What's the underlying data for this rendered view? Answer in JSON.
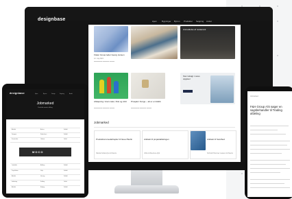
{
  "monitor": {
    "logo": "designbase",
    "nav": [
      "Hjem",
      "Bygninger",
      "Byrum",
      "Produkter",
      "Søgning",
      "Andet"
    ],
    "cards": [
      {
        "title": "Fisker Group leder Georg Jensen",
        "date": "12. maj 2024"
      },
      {
        "title": "Anmeldelse af restaurant",
        "date": ""
      },
      {
        "title": "Afslapning: Grøn natur, frisk og vildt",
        "date": ""
      },
      {
        "title": "Prosjekt i Norge – alt er en fabrik",
        "date": ""
      },
      {
        "title": "Stor indsigt i vores opgaver",
        "date": ""
      }
    ],
    "jobs_heading": "Jobmarked",
    "job_cards": [
      {
        "title": "Produktionsmedarbejder til Neuer Berlin",
        "company": "Nikolai Kotlarczyk Architects"
      },
      {
        "title": "Arkitekt til projektafdelingen",
        "company": "Ulrik Architecture ApS"
      },
      {
        "title": "Arkitekt til Sundhed",
        "company": "Schmidt Hammer Lassen Architects"
      }
    ]
  },
  "tablet": {
    "logo": "designbase",
    "nav": [
      "Hjem",
      "Byrum",
      "Design",
      "Søgning",
      "Andet"
    ],
    "title": "Jobmarked",
    "subtitle": "Find din næste stilling",
    "banner_text": "MOCO",
    "rows": [
      {
        "c1": "Arkitekt",
        "c2": "Aarhus",
        "c3": "Fuldtid"
      },
      {
        "c1": "Designer",
        "c2": "København",
        "c3": "Fuldtid"
      },
      {
        "c1": "Konstruktør",
        "c2": "Odense",
        "c3": "Deltid"
      },
      {
        "c1": "Landskab",
        "c2": "Aalborg",
        "c3": "Fuldtid"
      },
      {
        "c1": "Projektleder",
        "c2": "Vejle",
        "c3": "Fuldtid"
      },
      {
        "c1": "Arkitekt",
        "c2": "Herning",
        "c3": "Fuldtid"
      },
      {
        "c1": "Indretning",
        "c2": "Kolding",
        "c3": "Deltid"
      },
      {
        "c1": "Arkitekt",
        "c2": "Esbjerg",
        "c3": "Fuldtid"
      }
    ]
  },
  "phone": {
    "title": "F&H Group A/S søger en sagsbehandler til Trading afdeling",
    "breadcrumb": "Jobmarked"
  },
  "colors": {
    "accent": "#1e2a4a",
    "device": "#141414"
  }
}
